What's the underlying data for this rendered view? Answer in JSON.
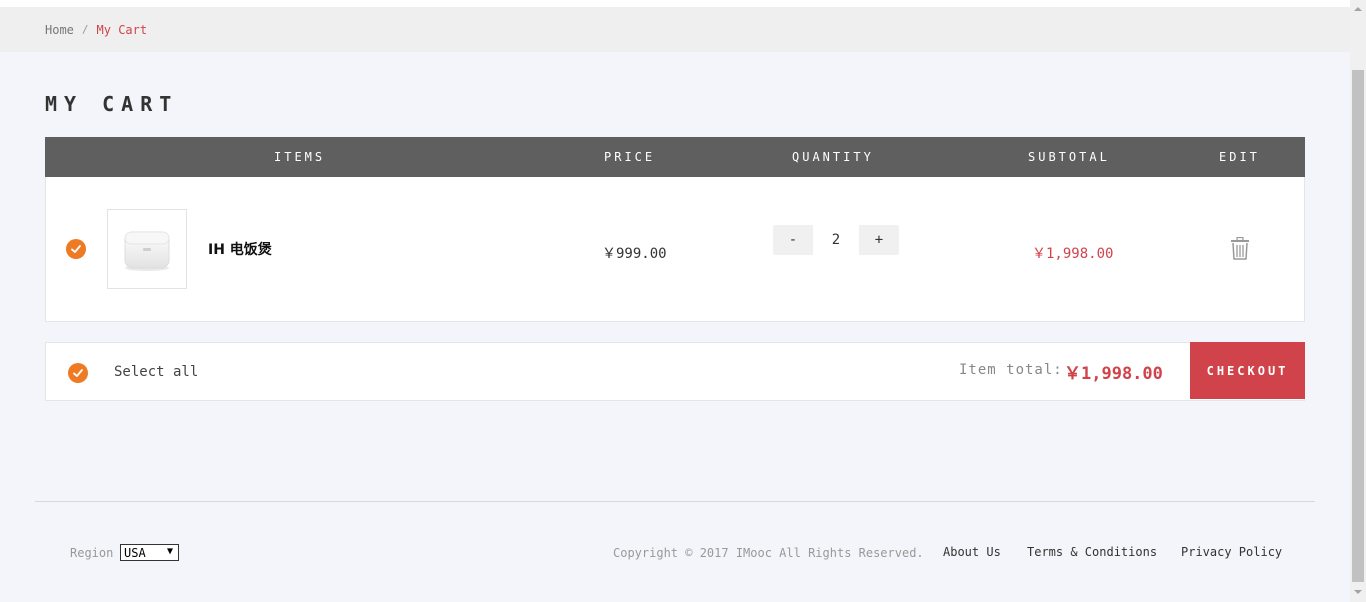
{
  "breadcrumb": {
    "home": "Home",
    "separator": "/",
    "current": "My Cart"
  },
  "page": {
    "title": "MY CART"
  },
  "table": {
    "headers": {
      "items": "ITEMS",
      "price": "PRICE",
      "quantity": "QUANTITY",
      "subtotal": "SUBTOTAL",
      "edit": "EDIT"
    }
  },
  "cart": {
    "items": [
      {
        "name": "IH 电饭煲",
        "price": "￥999.00",
        "quantity": "2",
        "subtotal": "￥1,998.00",
        "checked": true,
        "thumb_icon": "rice-cooker-image"
      }
    ],
    "qty_minus": "-",
    "qty_plus": "+"
  },
  "summary": {
    "select_all": "Select all",
    "total_label": "Item total:",
    "total_value": "￥1,998.00",
    "checkout": "CHECKOUT"
  },
  "footer": {
    "region_label": "Region",
    "region_value": "USA",
    "copyright": "Copyright © 2017 IMooc All Rights Reserved.",
    "links": [
      "About Us",
      "Terms & Conditions",
      "Privacy Policy"
    ]
  },
  "colors": {
    "accent": "#d1434b",
    "check": "#ee7a23",
    "header_bg": "#605f5f"
  }
}
